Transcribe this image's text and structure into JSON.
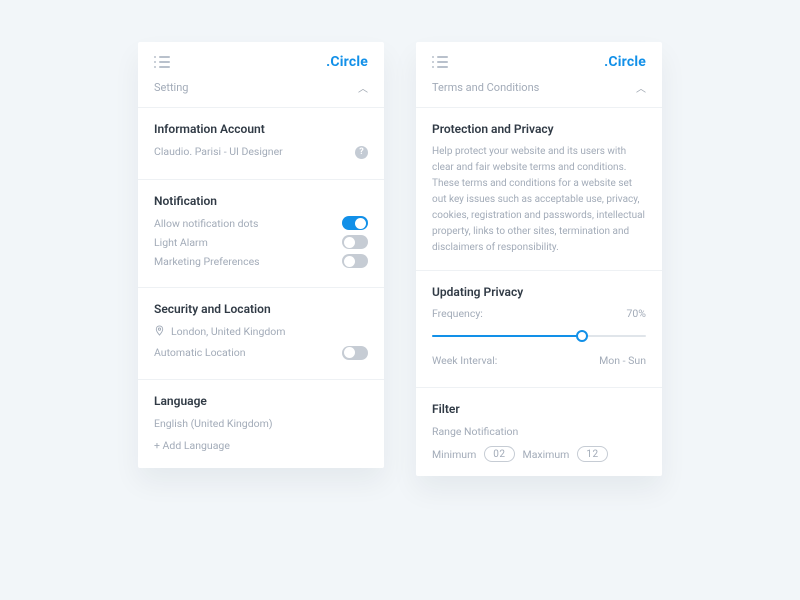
{
  "brand": ".Circle",
  "left": {
    "subhead": "Setting",
    "info": {
      "title": "Information Account",
      "subtitle": "Claudio. Parisi - UI Designer"
    },
    "notif": {
      "title": "Notification",
      "items": [
        {
          "label": "Allow notification dots",
          "on": true
        },
        {
          "label": "Light Alarm",
          "on": false
        },
        {
          "label": "Marketing Preferences",
          "on": false
        }
      ]
    },
    "security": {
      "title": "Security and Location",
      "location": "London, United Kingdom",
      "auto": {
        "label": "Automatic Location",
        "on": false
      }
    },
    "language": {
      "title": "Language",
      "current": "English (United Kingdom)",
      "add": "+ Add Language"
    }
  },
  "right": {
    "subhead": "Terms and Conditions",
    "protection": {
      "title": "Protection and Privacy",
      "body": "Help protect your website and its users with clear and fair website terms and conditions. These terms and conditions for a website set out key issues such as acceptable use, privacy, cookies, registration and passwords, intellectual property, links to other sites, termination and disclaimers of responsibility."
    },
    "updating": {
      "title": "Updating Privacy",
      "freq_label": "Frequency:",
      "freq_value": "70%",
      "freq_pct": 70,
      "week_label": "Week Interval:",
      "week_value": "Mon - Sun"
    },
    "filter": {
      "title": "Filter",
      "range_label": "Range Notification",
      "min_label": "Minimum",
      "min_value": "02",
      "max_label": "Maximum",
      "max_value": "12"
    }
  }
}
